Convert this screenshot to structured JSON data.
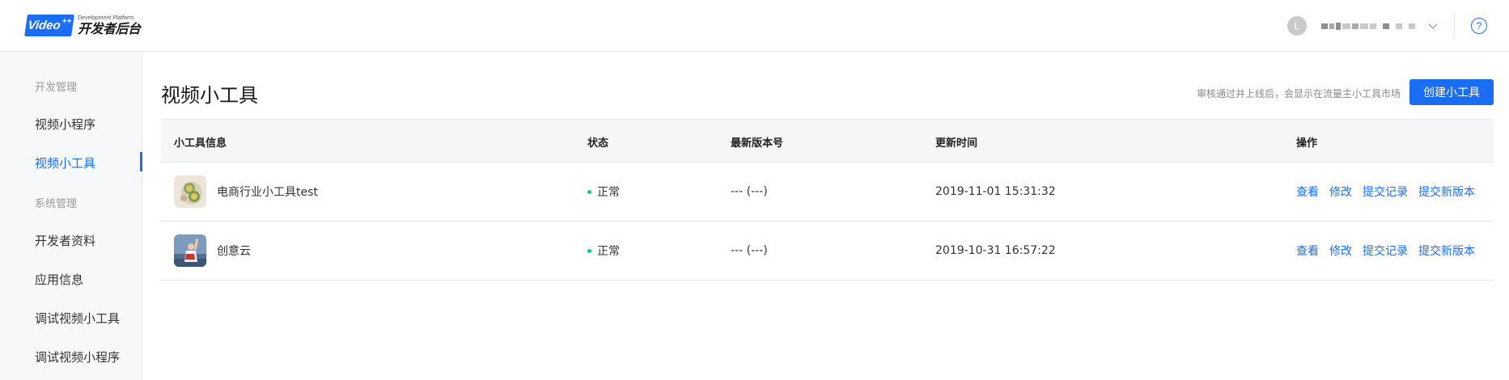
{
  "header": {
    "logo_badge": "Video",
    "logo_badge_sup": "++",
    "logo_subtitle": "Development Platform",
    "logo_title": "开发者后台",
    "avatar_letter": "L",
    "help_label": "?"
  },
  "sidebar": {
    "groups": [
      {
        "label": "开发管理"
      },
      {
        "label": "系统管理"
      }
    ],
    "items": [
      {
        "label": "视频小程序"
      },
      {
        "label": "视频小工具"
      },
      {
        "label": "开发者资料"
      },
      {
        "label": "应用信息"
      },
      {
        "label": "调试视频小工具"
      },
      {
        "label": "调试视频小程序"
      }
    ],
    "active_item": "视频小工具"
  },
  "main": {
    "title": "视频小工具",
    "hint": "审核通过并上线后，会显示在流量主小工具市场",
    "create_button": "创建小工具"
  },
  "table": {
    "columns": [
      "小工具信息",
      "状态",
      "最新版本号",
      "更新时间",
      "操作"
    ],
    "rows": [
      {
        "name": "电商行业小工具test",
        "status": "正常",
        "version": "--- (---)",
        "updated": "2019-11-01 15:31:32",
        "actions": [
          "查看",
          "修改",
          "提交记录",
          "提交新版本"
        ]
      },
      {
        "name": "创意云",
        "status": "正常",
        "version": "--- (---)",
        "updated": "2019-10-31 16:57:22",
        "actions": [
          "查看",
          "修改",
          "提交记录",
          "提交新版本"
        ]
      }
    ]
  },
  "colors": {
    "accent": "#1b6ef3",
    "status_ok": "#18c19c"
  }
}
